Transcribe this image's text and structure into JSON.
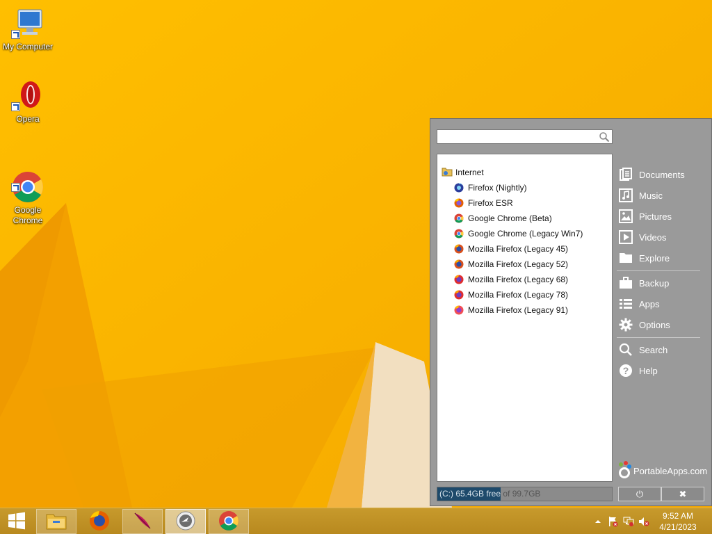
{
  "desktop": {
    "icons": [
      {
        "label": "My Computer"
      },
      {
        "label": "Opera"
      },
      {
        "label": "Google\nChrome"
      }
    ]
  },
  "menu": {
    "search": {
      "value": "",
      "placeholder": ""
    },
    "folder": "Internet",
    "apps": [
      {
        "label": "Firefox (Nightly)",
        "icon": "firefox-nightly-icon"
      },
      {
        "label": "Firefox ESR",
        "icon": "firefox-icon"
      },
      {
        "label": "Google Chrome (Beta)",
        "icon": "chrome-icon"
      },
      {
        "label": "Google Chrome (Legacy Win7)",
        "icon": "chrome-icon"
      },
      {
        "label": "Mozilla Firefox (Legacy 45)",
        "icon": "firefox-icon"
      },
      {
        "label": "Mozilla Firefox (Legacy 52)",
        "icon": "firefox-icon"
      },
      {
        "label": "Mozilla Firefox (Legacy 68)",
        "icon": "firefox-icon"
      },
      {
        "label": "Mozilla Firefox (Legacy 78)",
        "icon": "firefox-icon"
      },
      {
        "label": "Mozilla Firefox (Legacy 91)",
        "icon": "firefox-icon"
      }
    ],
    "links": {
      "documents": "Documents",
      "music": "Music",
      "pictures": "Pictures",
      "videos": "Videos",
      "explore": "Explore",
      "backup": "Backup",
      "apps": "Apps",
      "options": "Options",
      "search": "Search",
      "help": "Help"
    },
    "brand": "PortableApps.com",
    "status": {
      "used_text": "(C:) 65.4GB free",
      "rest_text": " of 99.7GB"
    },
    "power_label": "⏻",
    "close_label": "✖"
  },
  "taskbar": {
    "clock_time": "9:52 AM",
    "clock_date": "4/21/2023"
  },
  "colors": {
    "wallpaper": "#f6b100",
    "menu_bg": "#9a9a9a",
    "taskbar": "#c2942a"
  }
}
